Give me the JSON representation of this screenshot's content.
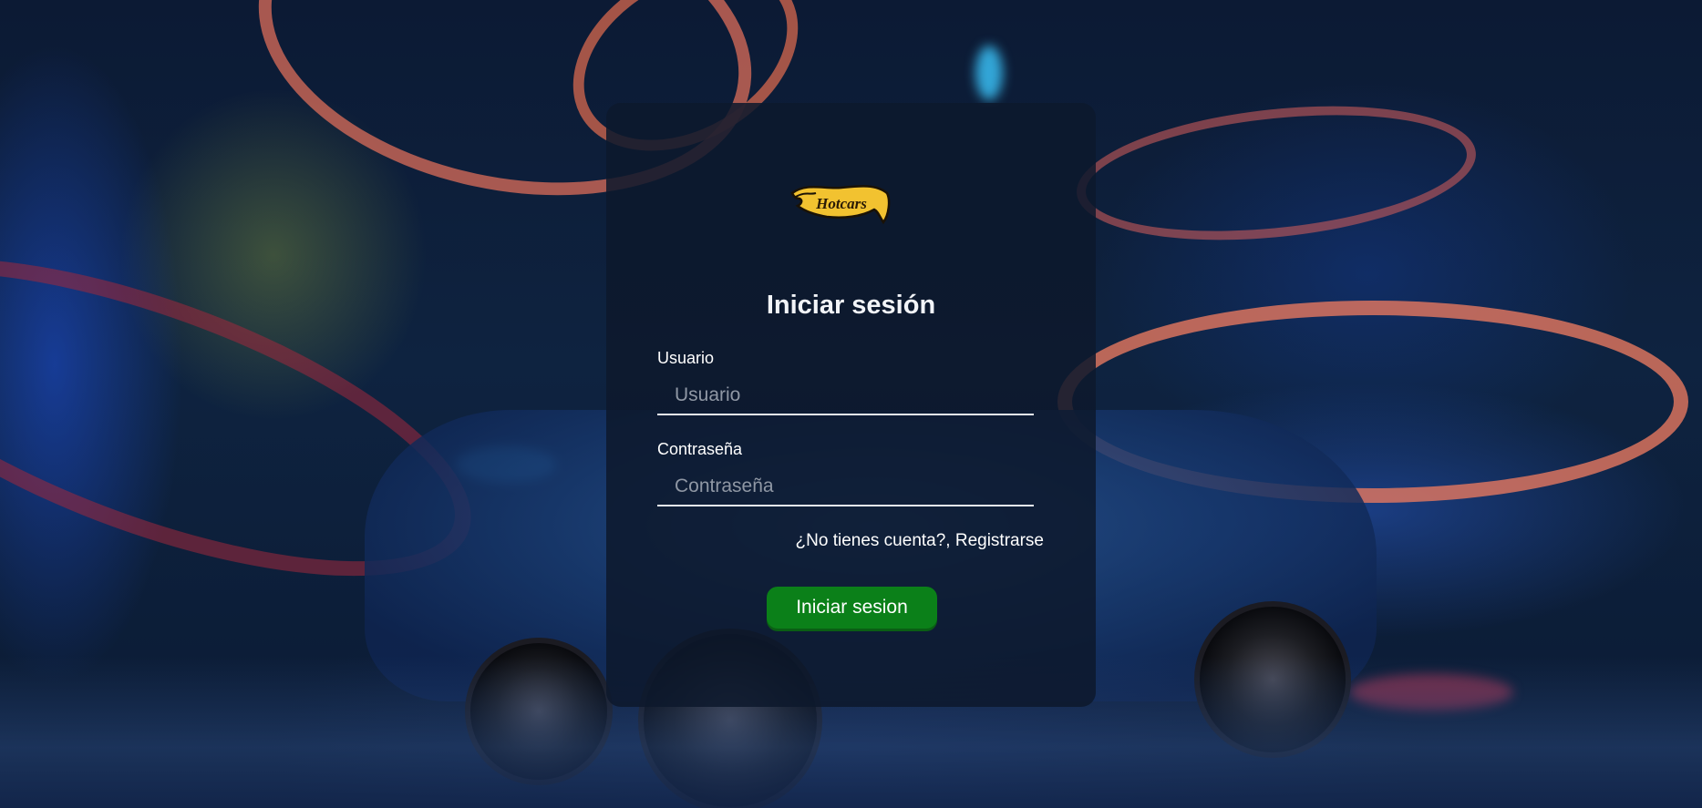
{
  "background": {
    "description_icon": "race-car-scene"
  },
  "logo": {
    "text": "Hotcars",
    "colors": {
      "flame": "#f2c230",
      "outline": "#1a1206",
      "text": "#2a1a05"
    }
  },
  "login": {
    "title": "Iniciar sesión",
    "username": {
      "label": "Usuario",
      "placeholder": "Usuario",
      "value": ""
    },
    "password": {
      "label": "Contraseña",
      "placeholder": "Contraseña",
      "value": ""
    },
    "register_link": "¿No tienes cuenta?, Registrarse",
    "submit_label": "Iniciar sesion"
  },
  "colors": {
    "card_bg": "#0d182c",
    "button_green": "#0b8019",
    "text": "#ffffff"
  }
}
